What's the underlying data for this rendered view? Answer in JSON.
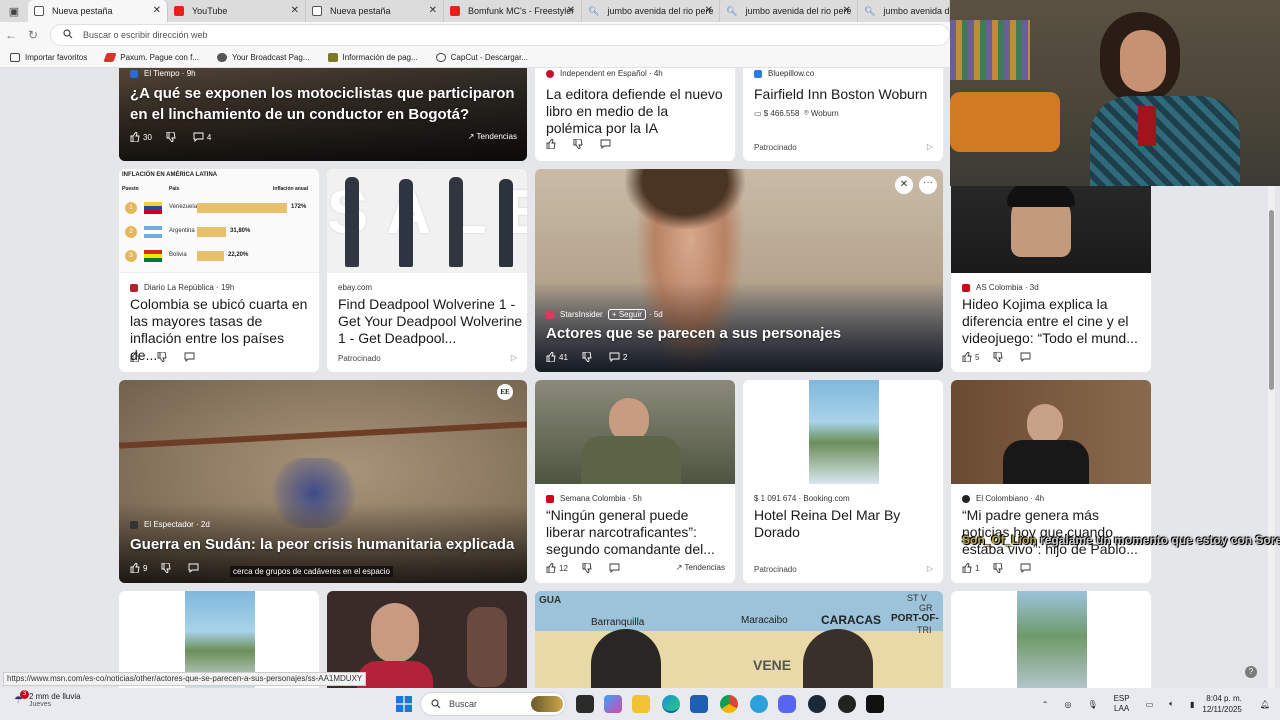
{
  "tabs": [
    {
      "label": "Nueva pestaña",
      "icon": "edge-icon",
      "active": true
    },
    {
      "label": "YouTube",
      "icon": "youtube-icon",
      "active": false
    },
    {
      "label": "Nueva pestaña",
      "icon": "edge-icon",
      "active": false
    },
    {
      "label": "Bomfunk MC's - Freestyler",
      "icon": "youtube-icon",
      "active": false
    },
    {
      "label": "jumbo avenida del rio pere",
      "icon": "search-icon",
      "active": false
    },
    {
      "label": "jumbo avenida del rio pere",
      "icon": "search-icon",
      "active": false
    },
    {
      "label": "jumbo avenida del",
      "icon": "search-icon",
      "active": false
    }
  ],
  "address": {
    "placeholder": "Buscar o escribir dirección web"
  },
  "bookmarks": [
    "Importar favoritos",
    "Paxum. Pague con f...",
    "Your Broadcast Pag...",
    "Información de pag...",
    "CapCut - Descargar..."
  ],
  "cards": {
    "c1": {
      "source": "El Tiempo",
      "age": "9h",
      "title": "¿A qué se exponen los motociclistas que participaron en el linchamiento de un conductor en Bogotá?",
      "likes": "30",
      "comments": "4",
      "trend": "Tendencias"
    },
    "c2": {
      "source": "Independent en Español",
      "age": "4h",
      "title": "La editora defiende el nuevo libro en medio de la polémica por la IA"
    },
    "c3": {
      "source": "Bluepillow.co",
      "title": "Fairfield Inn Boston Woburn",
      "price": "$ 466.558",
      "location": "Woburn",
      "sponsored": "Patrocinado"
    },
    "c4": {
      "source": "Diario La República",
      "age": "19h",
      "title": "Colombia se ubicó cuarta en las mayores tasas de inflación entre los países de...",
      "infographic": {
        "heading": "INFLACIÓN EN AMÉRICA LATINA",
        "col_rank": "Puesto",
        "col_country": "País",
        "col_value": "Inflación anual",
        "rows": [
          {
            "rank": "1",
            "country": "Venezuela",
            "value": "172%",
            "fraction": 0.95
          },
          {
            "rank": "2",
            "country": "Argentina",
            "value": "31,80%",
            "fraction": 0.3
          },
          {
            "rank": "3",
            "country": "Bolivia",
            "value": "22,20%",
            "fraction": 0.28
          }
        ]
      }
    },
    "c5": {
      "source": "ebay.com",
      "title": "Find Deadpool Wolverine 1 - Get Your Deadpool Wolverine 1 - Get Deadpool...",
      "sponsored": "Patrocinado",
      "watermark": "SALE"
    },
    "c6": {
      "source": "StarsInsider",
      "follow": "+ Seguir",
      "age": "5d",
      "title": "Actores que se parecen a sus personajes",
      "likes": "41",
      "comments": "2"
    },
    "c7": {
      "source": "AS Colombia",
      "age": "3d",
      "title": "Hideo Kojima explica la diferencia entre el cine y el videojuego: “Todo el mund...",
      "likes": "5"
    },
    "c8": {
      "source": "El Espectador",
      "age": "2d",
      "title": "Guerra en Sudán: la peor crisis humanitaria explicada",
      "likes": "9",
      "caption": "cerca de grupos de cadáveres en el espacio",
      "badge": "EE"
    },
    "c9": {
      "source": "Semana Colombia",
      "age": "5h",
      "title": "“Ningún general puede liberar narcotraficantes”: segundo comandante del...",
      "likes": "12",
      "trend": "Tendencias"
    },
    "c10": {
      "price_source": "$ 1 091 674 · Booking.com",
      "title": "Hotel Reina Del Mar By Dorado",
      "sponsored": "Patrocinado"
    },
    "c11": {
      "source": "El Colombiano",
      "age": "4h",
      "title": "“Mi padre genera más noticias hoy que cuando estaba vivo”: hijo de Pablo...",
      "likes": "1"
    },
    "c14": {
      "map_labels": [
        "GUA",
        "Barranquilla",
        "Maracaibo",
        "CARACAS",
        "PORT-OF-",
        "VENE",
        "ST V",
        "GR",
        "TRI"
      ]
    }
  },
  "overlay": {
    "chat_name": "Son_Of_Lion",
    "chat_text": "regalame un momento que estoy con Soren"
  },
  "status_url": "https://www.msn.com/es-co/noticias/other/actores-que-se-parecen-a-sus-personajes/ss-AA1MDUXY",
  "taskbar": {
    "weather_badge": "3",
    "weather_line1": "2 mm de lluvia",
    "weather_line2": "Jueves",
    "search": "Buscar",
    "lang1": "ESP",
    "lang2": "LAA",
    "time": "8:04 p. m.",
    "date": "12/11/2025"
  },
  "colors": {
    "accent": "#0067c0",
    "page_bg": "#e4e6ea",
    "tab_bar": "#dcdcdc"
  }
}
